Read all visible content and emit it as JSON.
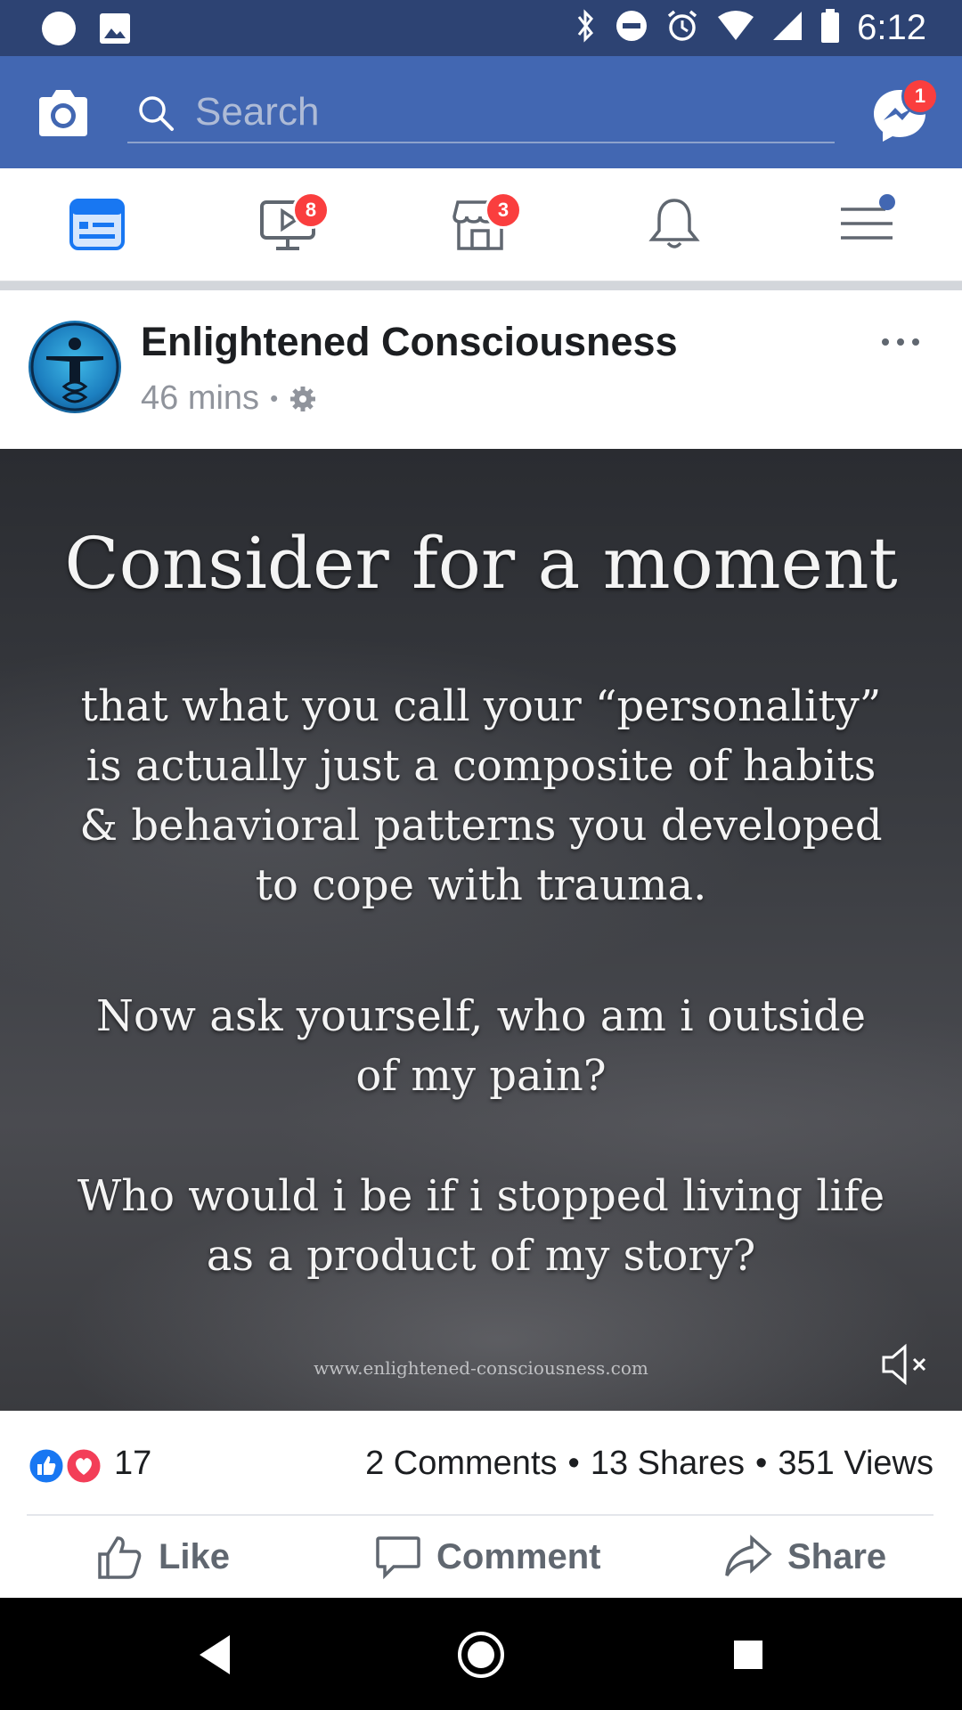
{
  "status_bar": {
    "time": "6:12",
    "icons": [
      "circle-notification-icon",
      "image-notification-icon",
      "bluetooth-icon",
      "do-not-disturb-icon",
      "alarm-icon",
      "wifi-icon",
      "cellular-signal-icon",
      "battery-icon"
    ]
  },
  "top_bar": {
    "search_placeholder": "Search",
    "messenger_badge": "1",
    "accent_color": "#4267b2"
  },
  "nav": {
    "items": [
      {
        "name": "news-feed",
        "icon": "news-feed-icon",
        "badge": "",
        "active": true
      },
      {
        "name": "watch",
        "icon": "video-icon",
        "badge": "8"
      },
      {
        "name": "marketplace",
        "icon": "marketplace-icon",
        "badge": "3"
      },
      {
        "name": "notifications",
        "icon": "bell-icon",
        "badge": ""
      },
      {
        "name": "menu",
        "icon": "hamburger-menu-icon",
        "badge": "",
        "dot": true
      }
    ]
  },
  "post": {
    "page_name": "Enlightened Consciousness",
    "time": "46 mins",
    "separator": "•",
    "privacy_icon": "gear-icon",
    "media": {
      "headline": "Consider for a moment",
      "para1": [
        "that what you call your “personality”",
        "is actually just a composite of habits",
        "& behavioral patterns you developed",
        "to cope with trauma."
      ],
      "para2": [
        "Now ask yourself, who am i outside",
        "of my pain?"
      ],
      "para3": [
        "Who would i be if i stopped living life",
        "as a product of my story?"
      ],
      "watermark": "www.enlightened-consciousness.com",
      "muted": true
    },
    "reactions": {
      "count": "17",
      "types": [
        "like",
        "love"
      ]
    },
    "comments": "2 Comments",
    "shares": "13 Shares",
    "views": "351 Views",
    "dot": "•",
    "actions": {
      "like": "Like",
      "comment": "Comment",
      "share": "Share"
    }
  },
  "system_nav": {
    "buttons": [
      "back-icon",
      "home-icon",
      "recents-icon"
    ]
  }
}
